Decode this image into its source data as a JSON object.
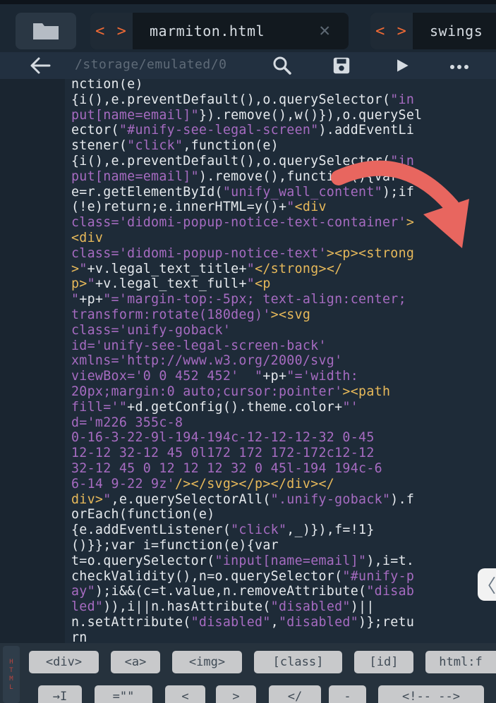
{
  "tabs": [
    {
      "icon": "< >",
      "label": "marmiton.html",
      "close": "✕"
    },
    {
      "icon": "< >",
      "label": "swings"
    }
  ],
  "toolbar": {
    "path": "/storage/emulated/0"
  },
  "code_lines": [
    [
      [
        "t",
        "nction(e)"
      ]
    ],
    [
      [
        "t",
        "{i(),e.preventDefault(),o.querySelector("
      ],
      [
        "s",
        "\"in"
      ]
    ],
    [
      [
        "s",
        "put[name=email]\""
      ],
      [
        "t",
        "}).remove(),w()}),o.querySel"
      ]
    ],
    [
      [
        "t",
        "ector("
      ],
      [
        "s",
        "\"#unify-see-legal-screen\""
      ],
      [
        "t",
        ").addEventLi"
      ]
    ],
    [
      [
        "t",
        "stener("
      ],
      [
        "s",
        "\"click\""
      ],
      [
        "t",
        ",function(e)"
      ]
    ],
    [
      [
        "t",
        "{i(),e.preventDefault(),o.querySelector("
      ],
      [
        "s",
        "\"in"
      ]
    ],
    [
      [
        "s",
        "put[name=email]\""
      ],
      [
        "t",
        ").remove(),function(){var"
      ]
    ],
    [
      [
        "t",
        "e=r.getElementById("
      ],
      [
        "s",
        "\"unify_wall_content\""
      ],
      [
        "t",
        ");if"
      ]
    ],
    [
      [
        "t",
        "(!e)return;e.innerHTML=y()+"
      ],
      [
        "s",
        "\""
      ],
      [
        "tg",
        "<div"
      ]
    ],
    [
      [
        "s",
        "class='didomi-popup-notice-text-container'"
      ],
      [
        "tg",
        ">"
      ]
    ],
    [
      [
        "tg",
        "<div"
      ]
    ],
    [
      [
        "s",
        "class='didomi-popup-notice-text'"
      ],
      [
        "tg",
        "><p><strong"
      ]
    ],
    [
      [
        "tg",
        ">"
      ],
      [
        "s",
        "\""
      ],
      [
        "t",
        "+v.legal_text_title+"
      ],
      [
        "s",
        "\""
      ],
      [
        "tg",
        "</strong></"
      ]
    ],
    [
      [
        "tg",
        "p>"
      ],
      [
        "s",
        "\""
      ],
      [
        "t",
        "+v.legal_text_full+"
      ],
      [
        "s",
        "\""
      ],
      [
        "tg",
        "<p"
      ]
    ],
    [
      [
        "s",
        "\""
      ],
      [
        "t",
        "+p+"
      ],
      [
        "s",
        "\"='margin-top:-5px; text-align:center;"
      ]
    ],
    [
      [
        "s",
        "transform:rotate(180deg)'"
      ],
      [
        "tg",
        "><svg"
      ]
    ],
    [
      [
        "s",
        "class='unify-goback'"
      ]
    ],
    [
      [
        "s",
        "id='unify-see-legal-screen-back'"
      ]
    ],
    [
      [
        "s",
        "xmlns='http://www.w3.org/2000/svg'"
      ]
    ],
    [
      [
        "s",
        "viewBox='0 0 452 452'  \""
      ],
      [
        "t",
        "+p+"
      ],
      [
        "s",
        "\"='width:"
      ]
    ],
    [
      [
        "s",
        "20px;margin:0 auto;cursor:pointer'"
      ],
      [
        "tg",
        "><path"
      ]
    ],
    [
      [
        "s",
        "fill='\""
      ],
      [
        "t",
        "+d.getConfig().theme.color+"
      ],
      [
        "s",
        "\"'"
      ]
    ],
    [
      [
        "s",
        "d='m226 355c-8"
      ]
    ],
    [
      [
        "s",
        "0-16-3-22-9l-194-194c-12-12-12-32 0-45"
      ]
    ],
    [
      [
        "s",
        "12-12 32-12 45 0l172 172 172-172c12-12"
      ]
    ],
    [
      [
        "s",
        "32-12 45 0 12 12 12 32 0 45l-194 194c-6"
      ]
    ],
    [
      [
        "s",
        "6-14 9-22 9z'"
      ],
      [
        "tg",
        "/></svg></p></div></"
      ]
    ],
    [
      [
        "tg",
        "div>"
      ],
      [
        "s",
        "\""
      ],
      [
        "t",
        ",e.querySelectorAll("
      ],
      [
        "s",
        "\".unify-goback\""
      ],
      [
        "t",
        ").f"
      ]
    ],
    [
      [
        "t",
        "orEach(function(e)"
      ]
    ],
    [
      [
        "t",
        "{e.addEventListener("
      ],
      [
        "s",
        "\"click\""
      ],
      [
        "t",
        ",_)}),f=!1}"
      ]
    ],
    [
      [
        "t",
        "()}};var i=function(e){var"
      ]
    ],
    [
      [
        "t",
        "t=o.querySelector("
      ],
      [
        "s",
        "\"input[name=email]\""
      ],
      [
        "t",
        "),i=t."
      ]
    ],
    [
      [
        "t",
        "checkValidity(),n=o.querySelector("
      ],
      [
        "s",
        "\"#unify-p"
      ]
    ],
    [
      [
        "s",
        "ay\""
      ],
      [
        "t",
        ");i&&(c=t.value,n.removeAttribute("
      ],
      [
        "s",
        "\"disab"
      ]
    ],
    [
      [
        "s",
        "led\""
      ],
      [
        "t",
        ")),i||n.hasAttribute("
      ],
      [
        "s",
        "\"disabled\""
      ],
      [
        "t",
        ")||"
      ]
    ],
    [
      [
        "t",
        "n.setAttribute("
      ],
      [
        "s",
        "\"disabled\""
      ],
      [
        "t",
        ","
      ],
      [
        "s",
        "\"disabled\""
      ],
      [
        "t",
        ")};retu"
      ]
    ],
    [
      [
        "t",
        "rn"
      ]
    ]
  ],
  "snippets": {
    "lang": [
      "H",
      "T",
      "M",
      "L"
    ],
    "row1": [
      "<div>",
      "<a>",
      "<img>",
      "[class]",
      "[id]",
      "html:f"
    ],
    "row2": [
      "→I",
      "=\"\"",
      "<",
      ">",
      "</",
      "-",
      "<!-- -->"
    ]
  },
  "colors": {
    "accent": "#f06a35",
    "string": "#a66bc1",
    "tag": "#e7b95a",
    "text": "#e6eaee",
    "annotation_arrow": "#e8665f"
  }
}
